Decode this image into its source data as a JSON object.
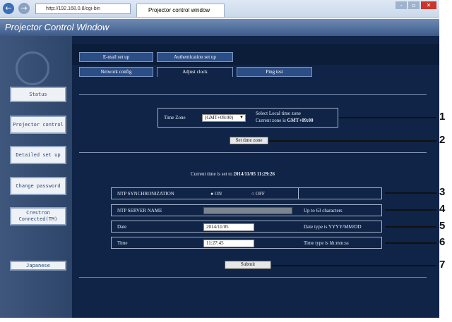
{
  "browser": {
    "address": "http://192.168.0.8/cgi-bin",
    "tab_title": "Projector control window",
    "back_icon": "back-arrow-icon",
    "forward_icon": "forward-arrow-icon"
  },
  "app": {
    "title": "Projector Control Window"
  },
  "sidebar": {
    "items": [
      {
        "label": "Status"
      },
      {
        "label": "Projector control"
      },
      {
        "label": "Detailed set up"
      },
      {
        "label": "Change password"
      },
      {
        "label": "Crestron Connected(TM)"
      },
      {
        "label": "Japanese"
      }
    ]
  },
  "tabs": [
    {
      "label": "E-mail set up"
    },
    {
      "label": "Authentication set up"
    },
    {
      "label": "Network config"
    },
    {
      "label": "Adjust clock"
    },
    {
      "label": "Ping test"
    }
  ],
  "timezone": {
    "label": "Time Zone",
    "selected": "(GMT+09:00)",
    "note_line1": "Select Local time zone",
    "note_line2_prefix": "Current zone is ",
    "note_line2_value": "GMT+09:00",
    "button": "Set time zone"
  },
  "current_time": {
    "prefix": "Current time is set to ",
    "value": "2014/11/05 11:29:26"
  },
  "ntp": {
    "sync_label": "NTP SYNCHRONIZATION",
    "on_label": "ON",
    "off_label": "OFF",
    "selected": "ON",
    "server_label": "NTP SERVER NAME",
    "server_value": "",
    "server_note": "Up to 63 characters"
  },
  "date": {
    "label": "Date",
    "value": "2014/11/05",
    "note": "Date type is YYYY/MM/DD"
  },
  "time": {
    "label": "Time",
    "value": "11:27:45",
    "note": "Time type is hh:mm:ss"
  },
  "submit": "Submit",
  "callouts": [
    "1",
    "2",
    "3",
    "4",
    "5",
    "6",
    "7"
  ]
}
